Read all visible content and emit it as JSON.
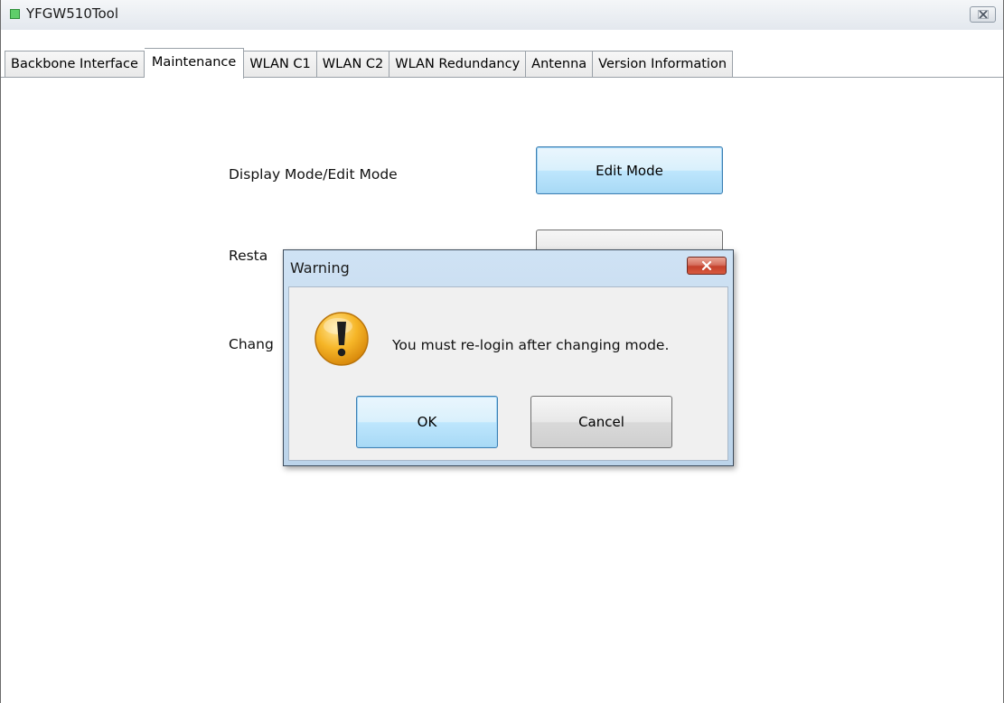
{
  "window": {
    "title": "YFGW510Tool"
  },
  "tabs": [
    {
      "label": "Backbone Interface",
      "active": false
    },
    {
      "label": "Maintenance",
      "active": true
    },
    {
      "label": "WLAN C1",
      "active": false
    },
    {
      "label": "WLAN C2",
      "active": false
    },
    {
      "label": "WLAN Redundancy",
      "active": false
    },
    {
      "label": "Antenna",
      "active": false
    },
    {
      "label": "Version Information",
      "active": false
    }
  ],
  "maintenance": {
    "display_mode_label": "Display Mode/Edit Mode",
    "edit_mode_button": "Edit Mode",
    "restart_label_visible": "Resta",
    "change_label_visible": "Chang"
  },
  "dialog": {
    "title": "Warning",
    "message": "You must re-login after changing mode.",
    "ok_button": "OK",
    "cancel_button": "Cancel",
    "icon": "warning-icon"
  },
  "colors": {
    "accent": "#3c7fb1",
    "dialog_frame": "#bcd4ea",
    "close_red": "#c4402c",
    "warning_yellow": "#f2a81c",
    "app_icon_green": "#5fce6a"
  }
}
